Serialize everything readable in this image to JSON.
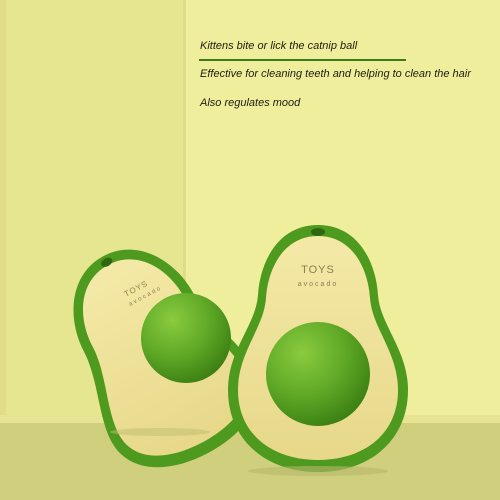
{
  "captions": [
    "Kittens bite or lick the catnip ball",
    "Effective for cleaning teeth and helping to clean the hair",
    "Also regulates mood"
  ],
  "product": {
    "name": "avocado cat toy",
    "brand_line_1": "TOYS",
    "brand_line_2": "avocado"
  },
  "colors": {
    "background": "#efee9c",
    "wall_shadow": "#dfdd88",
    "floor": "#cfcf7e",
    "shell_green": "#4e9a1e",
    "body_cream": "#efe29a",
    "ball_green": "#62ad26",
    "accent_line": "#3e7a18"
  }
}
